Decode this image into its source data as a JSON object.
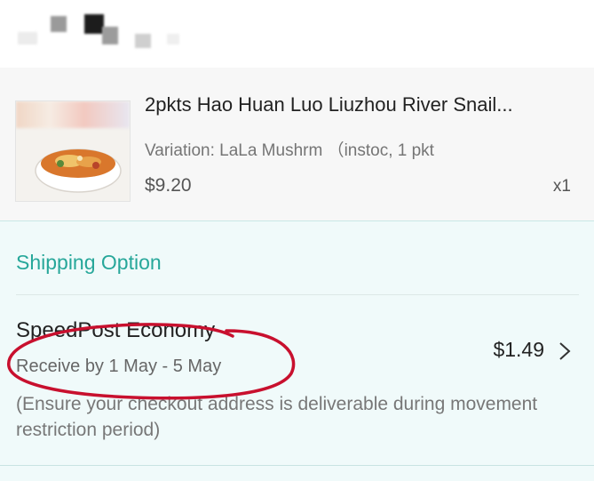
{
  "product": {
    "title": "2pkts Hao Huan Luo Liuzhou River Snail...",
    "variation": "Variation: LaLa Mushrm （instoc, 1 pkt",
    "price": "$9.20",
    "quantity": "x1"
  },
  "shipping": {
    "section_title": "Shipping Option",
    "method": "SpeedPost Economy",
    "receive_by": "Receive by 1 May - 5 May",
    "note": "(Ensure your checkout address is deliverable during movement restriction period)",
    "price": "$1.49"
  },
  "colors": {
    "accent": "#27a79a",
    "annotation": "#c8102e"
  },
  "icons": [
    "chevron-right-icon"
  ]
}
